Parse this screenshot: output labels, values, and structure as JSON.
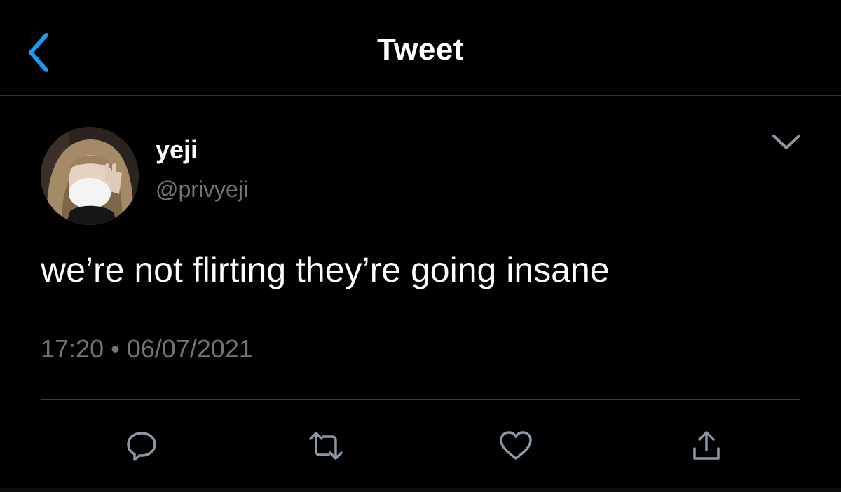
{
  "header": {
    "title": "Tweet",
    "back_icon": "chevron-left-icon",
    "accent_color": "#1d9bf0"
  },
  "tweet": {
    "author": {
      "display_name": "yeji",
      "handle": "@privyeji",
      "avatar": "profile-photo"
    },
    "more_icon": "chevron-down-icon",
    "text": "we’re not flirting they’re going insane",
    "timestamp": "17:20 • 06/07/2021"
  },
  "actions": [
    {
      "name": "reply",
      "icon": "reply-icon"
    },
    {
      "name": "retweet",
      "icon": "retweet-icon"
    },
    {
      "name": "like",
      "icon": "heart-icon"
    },
    {
      "name": "share",
      "icon": "share-icon"
    }
  ],
  "colors": {
    "background": "#000000",
    "text": "#ffffff",
    "secondary_text": "#71767b",
    "icon": "#8b98a5"
  }
}
